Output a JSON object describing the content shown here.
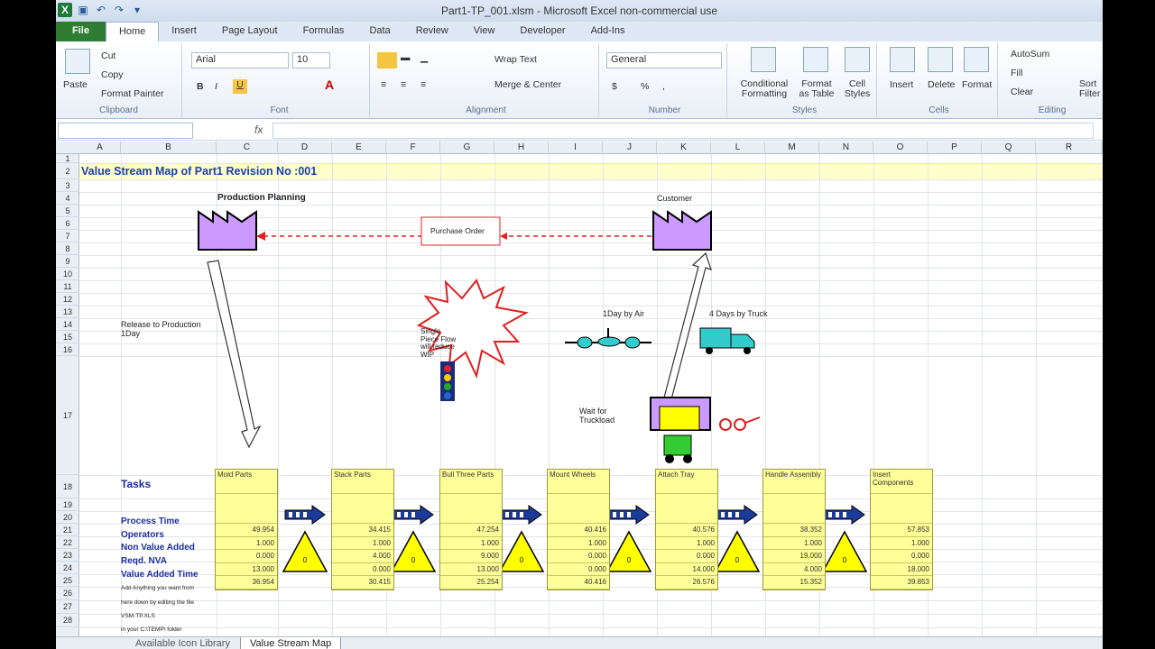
{
  "window": {
    "title": "Part1-TP_001.xlsm - Microsoft Excel non-commercial use"
  },
  "ribbon_tabs": [
    "File",
    "Home",
    "Insert",
    "Page Layout",
    "Formulas",
    "Data",
    "Review",
    "View",
    "Developer",
    "Add-Ins"
  ],
  "ribbon": {
    "clipboard": {
      "paste": "Paste",
      "cut": "Cut",
      "copy": "Copy",
      "format_painter": "Format Painter",
      "label": "Clipboard"
    },
    "font": {
      "name": "Arial",
      "size": "10",
      "label": "Font",
      "bold": "B",
      "italic": "I",
      "underline": "U"
    },
    "alignment": {
      "wrap": "Wrap Text",
      "merge": "Merge & Center",
      "label": "Alignment"
    },
    "number": {
      "format": "General",
      "label": "Number",
      "currency": "$",
      "percent": "%",
      "comma": ","
    },
    "styles": {
      "cond": "Conditional Formatting",
      "table": "Format as Table",
      "cell": "Cell Styles",
      "label": "Styles"
    },
    "cells": {
      "insert": "Insert",
      "delete": "Delete",
      "format": "Format",
      "label": "Cells"
    },
    "editing": {
      "autosum": "AutoSum",
      "fill": "Fill",
      "clear": "Clear",
      "sort": "Sort Filter",
      "label": "Editing"
    }
  },
  "formula_bar": {
    "fx": "fx"
  },
  "columns": [
    "A",
    "B",
    "C",
    "D",
    "E",
    "F",
    "G",
    "H",
    "I",
    "J",
    "K",
    "L",
    "M",
    "N",
    "O",
    "P",
    "Q",
    "R"
  ],
  "rows": [
    "1",
    "2",
    "3",
    "4",
    "5",
    "6",
    "7",
    "8",
    "9",
    "10",
    "11",
    "12",
    "13",
    "14",
    "15",
    "16",
    "17",
    "18",
    "19",
    "20",
    "21",
    "22",
    "23",
    "24",
    "25",
    "26",
    "27",
    "28"
  ],
  "sheet": {
    "title": "Value Stream Map of Part1 Revision No :001",
    "production_planning": "Production Planning",
    "customer": "Customer",
    "purchase_order": "Purchase Order",
    "release": "Release to Production 1Day",
    "air": "1Day by Air",
    "truck": "4 Days by Truck",
    "wait": "Wait for Truckload",
    "kaizen": "Single Piece Flow will reduce WIP",
    "tasks_label": "Tasks",
    "row_labels": [
      "Process Time",
      "Operators",
      "Non Value Added",
      "Reqd. NVA",
      "Value Added Time"
    ],
    "notes": [
      "Add Anything you want from",
      "here down by editing the file",
      "VSM-TP.XLS",
      "in your C:\\TEMP\\ folder"
    ],
    "tasks": [
      {
        "name": "Mold Parts",
        "values": [
          "49.954",
          "1.000",
          "0.000",
          "13.000",
          "36.954"
        ]
      },
      {
        "name": "Stack Parts",
        "values": [
          "34.415",
          "1.000",
          "4.000",
          "0.000",
          "30.415"
        ]
      },
      {
        "name": "Bull Three Parts",
        "values": [
          "47.254",
          "1.000",
          "9.000",
          "13.000",
          "25.254"
        ]
      },
      {
        "name": "Mount Wheels",
        "values": [
          "40.416",
          "1.000",
          "0.000",
          "0.000",
          "40.416"
        ]
      },
      {
        "name": "Attach Tray",
        "values": [
          "40.576",
          "1.000",
          "0.000",
          "14.000",
          "26.576"
        ]
      },
      {
        "name": "Handle Assembly",
        "values": [
          "38.352",
          "1.000",
          "19.000",
          "4.000",
          "15.352"
        ]
      },
      {
        "name": "Insert Components",
        "values": [
          "57.853",
          "1.000",
          "0.000",
          "18.000",
          "39.853"
        ]
      }
    ],
    "inventory": [
      "0",
      "0",
      "0",
      "0",
      "0",
      "0"
    ]
  },
  "sheet_tabs": [
    "Available Icon Library",
    "Value Stream Map"
  ],
  "colors": {
    "accent": "#1a3fb0",
    "factory": "#cc99ff",
    "task": "#ffff99",
    "triangle": "#ffff00",
    "cyan": "#33cccc",
    "red": "#e02020"
  }
}
